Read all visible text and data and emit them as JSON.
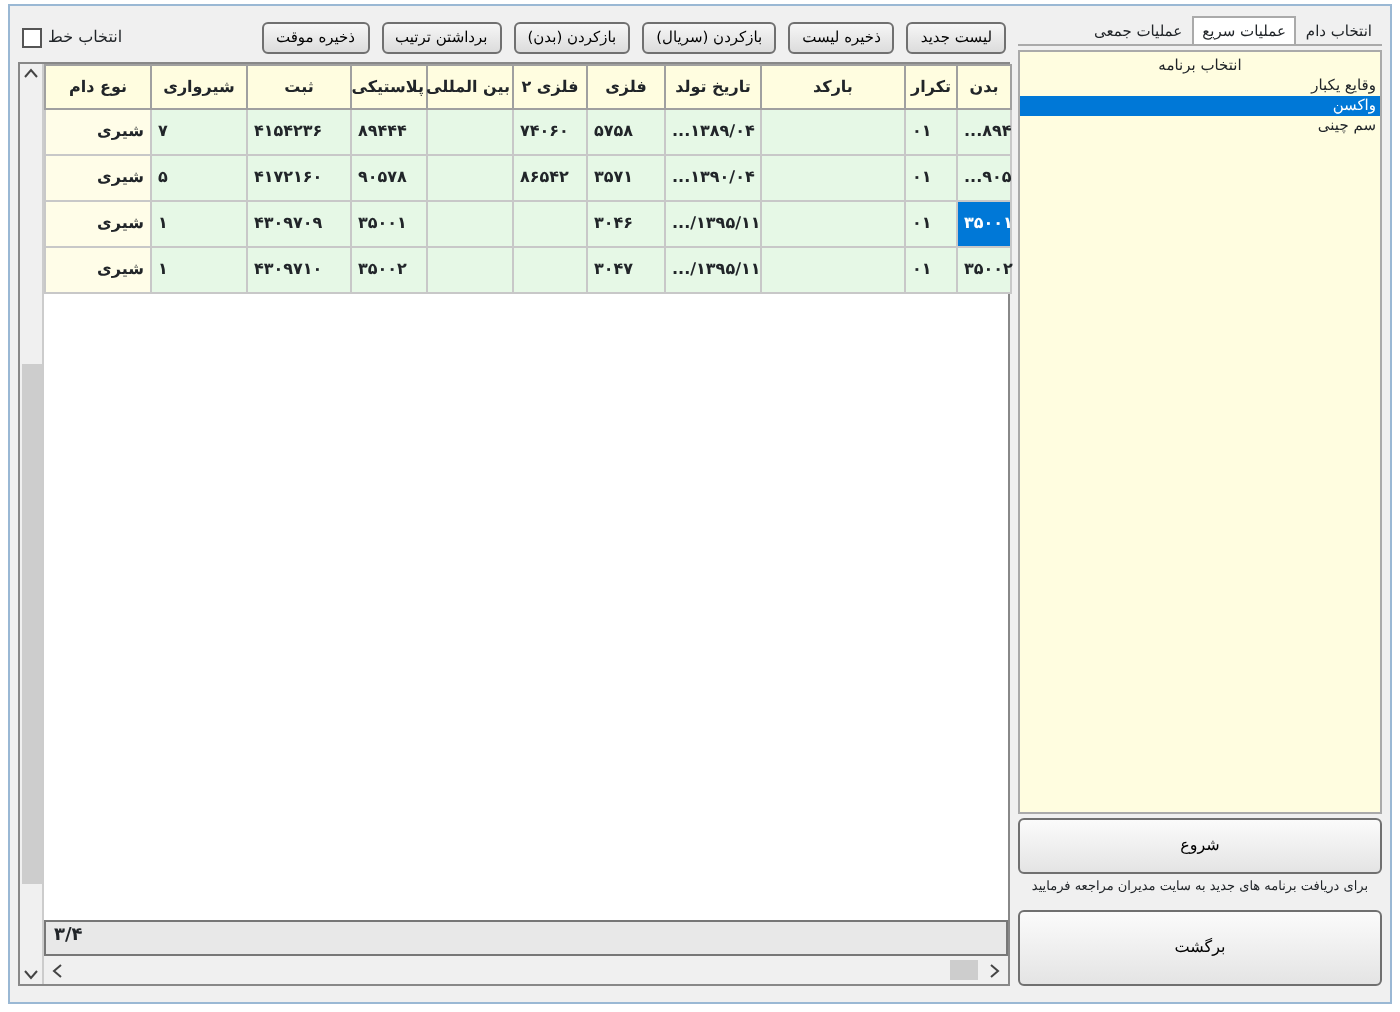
{
  "toolbar": {
    "select_row": {
      "label": "انتخاب خط",
      "checked": false
    },
    "buttons": [
      "لیست جدید",
      "ذخیره لیست",
      "بازکردن (سریال)",
      "بازکردن (بدن)",
      "برداشتن ترتیب",
      "ذخیره موقت"
    ]
  },
  "table": {
    "columns": [
      "بدن",
      "تکرار",
      "بارکد",
      "تاریخ تولد",
      "فلزی",
      "فلزی ۲",
      "بین المللی",
      "پلاستیکی",
      "ثبت",
      "شیرواری",
      "نوع دام"
    ],
    "rows": [
      {
        "selected": false,
        "cells": [
          "...۸۹۴",
          "۰۱",
          "",
          "...۱۳۸۹/۰۴",
          "۵۷۵۸",
          "۷۴۰۶۰",
          "",
          "۸۹۴۴۴",
          "۴۱۵۴۲۳۶",
          "۷",
          "شیری"
        ]
      },
      {
        "selected": false,
        "cells": [
          "...۹۰۵",
          "۰۱",
          "",
          "...۱۳۹۰/۰۴",
          "۳۵۷۱",
          "۸۶۵۴۲",
          "",
          "۹۰۵۷۸",
          "۴۱۷۲۱۶۰",
          "۵",
          "شیری"
        ]
      },
      {
        "selected": true,
        "cells": [
          "۳۵۰۰۱",
          "۰۱",
          "",
          ".../۱۳۹۵/۱۱",
          "۳۰۴۶",
          "",
          "",
          "۳۵۰۰۱",
          "۴۳۰۹۷۰۹",
          "۱",
          "شیری"
        ]
      },
      {
        "selected": false,
        "cells": [
          "۳۵۰۰۲",
          "۰۱",
          "",
          ".../۱۳۹۵/۱۱",
          "۳۰۴۷",
          "",
          "",
          "۳۵۰۰۲",
          "۴۳۰۹۷۱۰",
          "۱",
          "شیری"
        ]
      }
    ]
  },
  "footer": {
    "count": "۳/۴"
  },
  "side": {
    "tabs": [
      {
        "label": "انتخاب دام",
        "selected": false
      },
      {
        "label": "عملیات سریع",
        "selected": true
      },
      {
        "label": "عملیات جمعی",
        "selected": false
      }
    ],
    "list_title": "انتخاب برنامه",
    "items": [
      {
        "label": "وقایع یکبار",
        "selected": false
      },
      {
        "label": "واکسن",
        "selected": true
      },
      {
        "label": "سم چینی",
        "selected": false
      }
    ],
    "start_button": "شروع",
    "note": "برای دریافت برنامه های جدید به سایت مدیران مراجعه فرمایید",
    "back_button": "برگشت"
  }
}
